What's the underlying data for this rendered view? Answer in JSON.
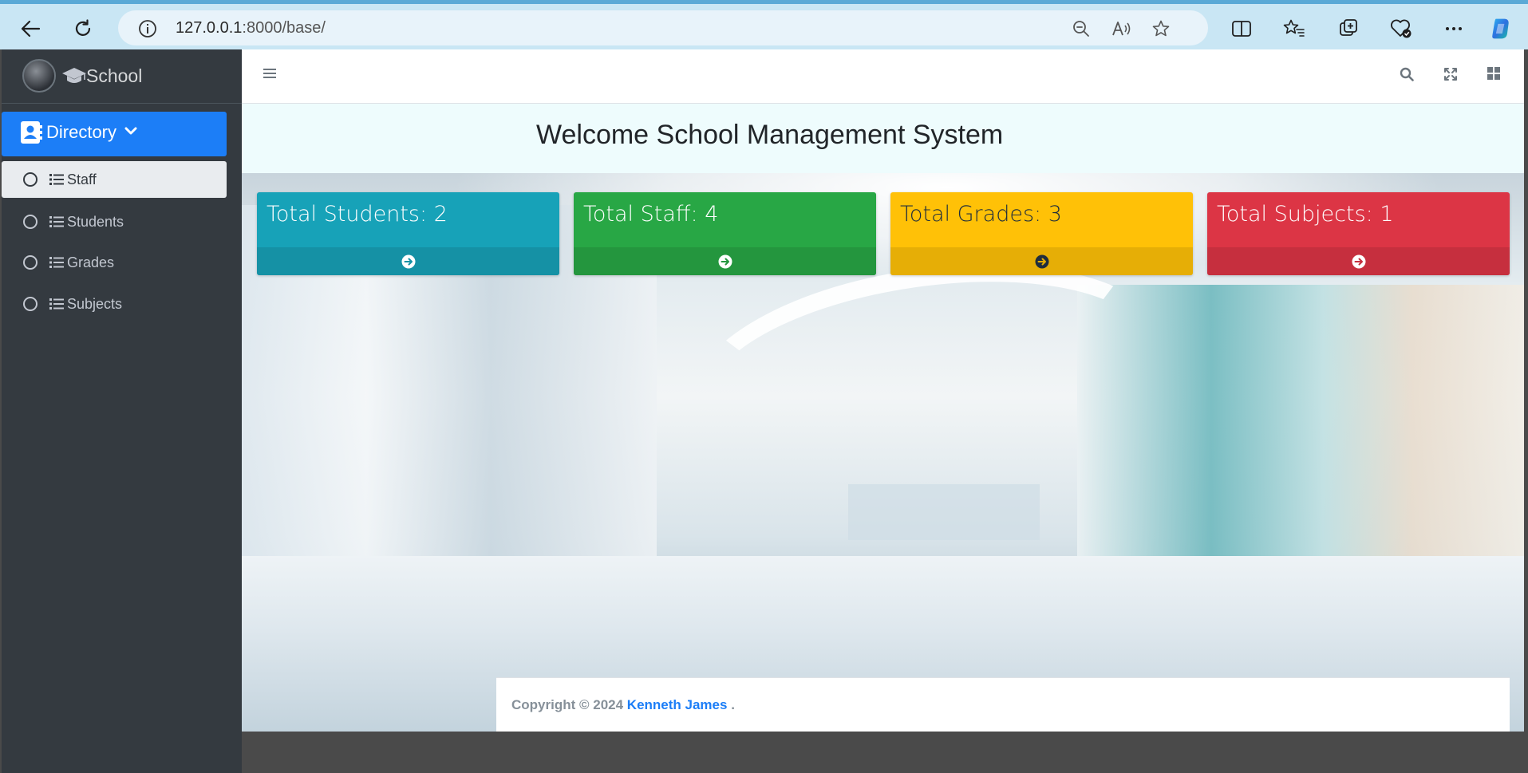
{
  "browser": {
    "url_host": "127.0.0.1",
    "url_rest": ":8000/base/"
  },
  "sidebar": {
    "brand": "School",
    "directory_label": "Directory",
    "items": [
      {
        "label": "Staff",
        "active": true
      },
      {
        "label": "Students",
        "active": false
      },
      {
        "label": "Grades",
        "active": false
      },
      {
        "label": "Subjects",
        "active": false
      }
    ]
  },
  "main": {
    "welcome_title": "Welcome School Management System",
    "cards": [
      {
        "label": "Total Students: 2",
        "color": "#17a2b8"
      },
      {
        "label": "Total Staff: 4",
        "color": "#28a745"
      },
      {
        "label": "Total Grades: 3",
        "color": "#ffc107"
      },
      {
        "label": "Total Subjects: 1",
        "color": "#dc3545"
      }
    ]
  },
  "footer": {
    "prefix": "Copyright © 2024 ",
    "author": "Kenneth James",
    "suffix": " ."
  },
  "colors": {
    "sidebar_bg": "#343a40",
    "accent": "#1c7ef7"
  }
}
